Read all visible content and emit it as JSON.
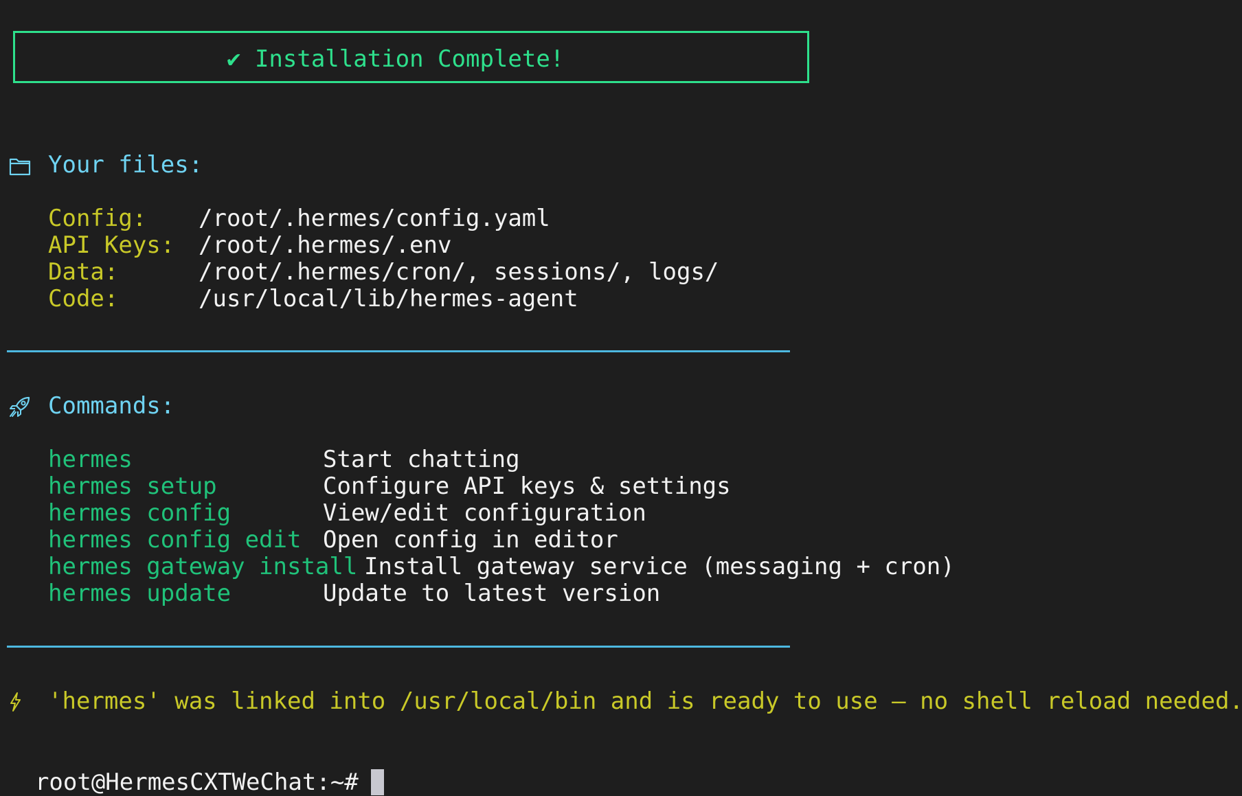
{
  "banner": {
    "text": "✔ Installation Complete!",
    "color": "#2ee08c"
  },
  "files": {
    "icon": "folder-icon",
    "heading": "Your files:",
    "rows": [
      {
        "label": "Config:",
        "value": "/root/.hermes/config.yaml"
      },
      {
        "label": "API Keys:",
        "value": "/root/.hermes/.env"
      },
      {
        "label": "Data:",
        "value": "/root/.hermes/cron/, sessions/, logs/"
      },
      {
        "label": "Code:",
        "value": "/usr/local/lib/hermes-agent"
      }
    ]
  },
  "commands": {
    "icon": "rocket-icon",
    "heading": "Commands:",
    "rows": [
      {
        "cmd": "hermes",
        "desc": "Start chatting"
      },
      {
        "cmd": "hermes setup",
        "desc": "Configure API keys & settings"
      },
      {
        "cmd": "hermes config",
        "desc": "View/edit configuration"
      },
      {
        "cmd": "hermes config edit",
        "desc": "Open config in editor"
      },
      {
        "cmd": "hermes gateway install",
        "desc": "Install gateway service (messaging + cron)"
      },
      {
        "cmd": "hermes update",
        "desc": "Update to latest version"
      }
    ]
  },
  "notice": {
    "icon": "lightning-icon",
    "text": "'hermes' was linked into /usr/local/bin and is ready to use — no shell reload needed."
  },
  "prompt": {
    "text": "root@HermesCXTWeChat:~#"
  },
  "colors": {
    "background": "#1e1e1e",
    "accent_green": "#2ee08c",
    "command_green": "#20c27a",
    "heading_cyan": "#6fd3f2",
    "label_yellow": "#c9c928",
    "rule_blue": "#4db8e0",
    "text_white": "#f2f2f2"
  }
}
